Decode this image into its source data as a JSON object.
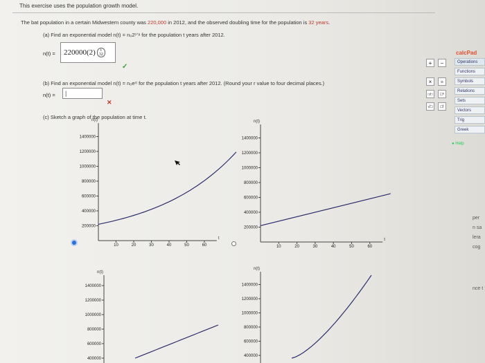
{
  "header": {
    "text": "This exercise uses the population growth model."
  },
  "problem": {
    "pre": "The bat population in a certain Midwestern county was ",
    "initial": "220,000",
    "mid": " in 2012, and the observed doubling time for the population is ",
    "doubling": "32 years",
    "post": "."
  },
  "part_a": {
    "prompt": "(a) Find an exponential model n(t) = n₀2ᵗᐟᵃ for the population t years after 2012.",
    "label": "n(t) =",
    "answer_base": "220000(2)",
    "exp_num": "t",
    "exp_den": "32",
    "status_icon": "check-icon"
  },
  "part_b": {
    "prompt": "(b) Find an exponential model n(t) = n₀eʳᵗ for the population t years after 2012. (Round your r value to four decimal places.)",
    "label": "n(t) =",
    "value": "|",
    "status_icon": "x-icon"
  },
  "part_c": {
    "prompt": "(c) Sketch a graph of the population at time t."
  },
  "graphs": {
    "ylabel": "n(t)",
    "xlabel": "t",
    "yticks": [
      "1400000",
      "1200000",
      "1000000",
      "800000",
      "600000",
      "400000",
      "200000"
    ],
    "xticks": [
      "10",
      "20",
      "30",
      "40",
      "50",
      "60"
    ]
  },
  "chart_data": [
    {
      "type": "line",
      "ylabel": "n(t)",
      "xlabel": "t",
      "series": [
        {
          "values": [
            [
              0,
              220000
            ],
            [
              10,
              271000
            ],
            [
              20,
              339000
            ],
            [
              30,
              420000
            ],
            [
              40,
              525000
            ],
            [
              50,
              650000
            ],
            [
              60,
              820000
            ],
            [
              70,
              1000000
            ],
            [
              80,
              1230000
            ]
          ]
        }
      ],
      "selected": true
    },
    {
      "type": "line",
      "ylabel": "n(t)",
      "xlabel": "t",
      "series": [
        {
          "values": [
            [
              0,
              220000
            ],
            [
              60,
              650000
            ]
          ]
        }
      ],
      "selected": false
    },
    {
      "type": "line",
      "ylabel": "n(t)",
      "xlabel": "t",
      "series": [
        {
          "values": [
            [
              0,
              0
            ],
            [
              60,
              750000
            ]
          ]
        }
      ]
    },
    {
      "type": "line",
      "ylabel": "n(t)",
      "xlabel": "t",
      "series": [
        {
          "values": [
            [
              0,
              0
            ],
            [
              60,
              1300000
            ]
          ]
        }
      ]
    }
  ],
  "calcpad": {
    "title": "calcPad",
    "tabs": [
      "Operations",
      "Functions",
      "Symbols",
      "Relations",
      "Sets",
      "Vectors",
      "Trig",
      "Greek"
    ],
    "help": "Help",
    "buttons": [
      "+",
      "−",
      "×",
      "÷",
      "□⁄□",
      "□ⁿ",
      "√□",
      "□!"
    ]
  },
  "right_fragments": [
    "per",
    "n sa",
    "lera",
    "cog",
    "nce t"
  ],
  "colors": {
    "curve": "#2c2c6a",
    "axis": "#444",
    "highlight": "#c0392b",
    "check": "#3a9c3a",
    "radio": "#2e6fd6"
  }
}
